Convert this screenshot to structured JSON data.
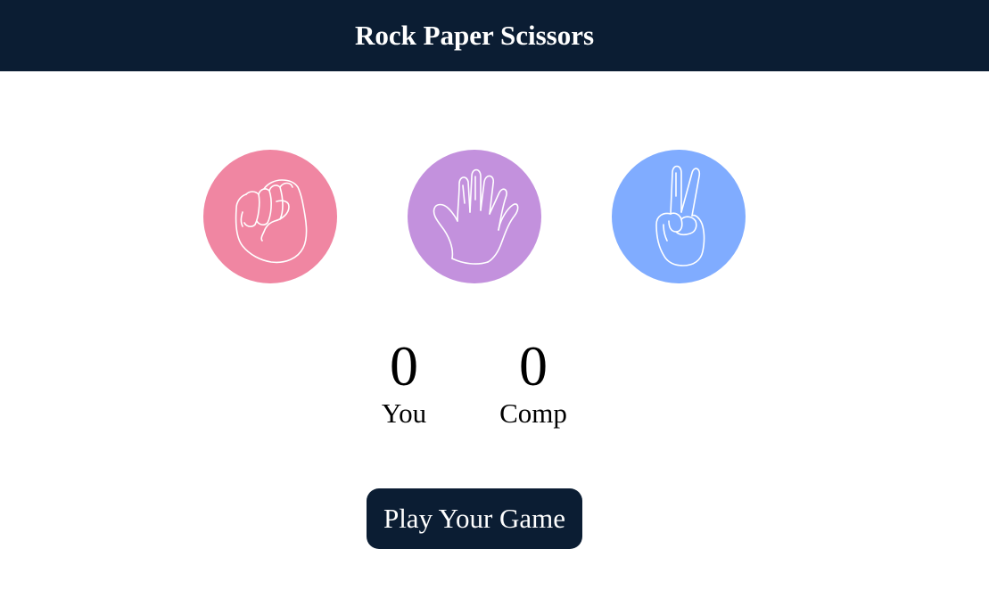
{
  "header": {
    "title": "Rock Paper Scissors"
  },
  "choices": [
    {
      "name": "rock",
      "icon": "fist-icon",
      "color": "#f086a2"
    },
    {
      "name": "paper",
      "icon": "open-hand-icon",
      "color": "#c391dd"
    },
    {
      "name": "scissors",
      "icon": "peace-sign-icon",
      "color": "#80acff"
    }
  ],
  "scoreboard": {
    "user": {
      "score": "0",
      "label": "You"
    },
    "computer": {
      "score": "0",
      "label": "Comp"
    }
  },
  "play_button": {
    "label": "Play Your Game"
  },
  "colors": {
    "header_bg": "#0b1d33",
    "button_bg": "#0b1d33",
    "icon_stroke": "#ffffff"
  }
}
